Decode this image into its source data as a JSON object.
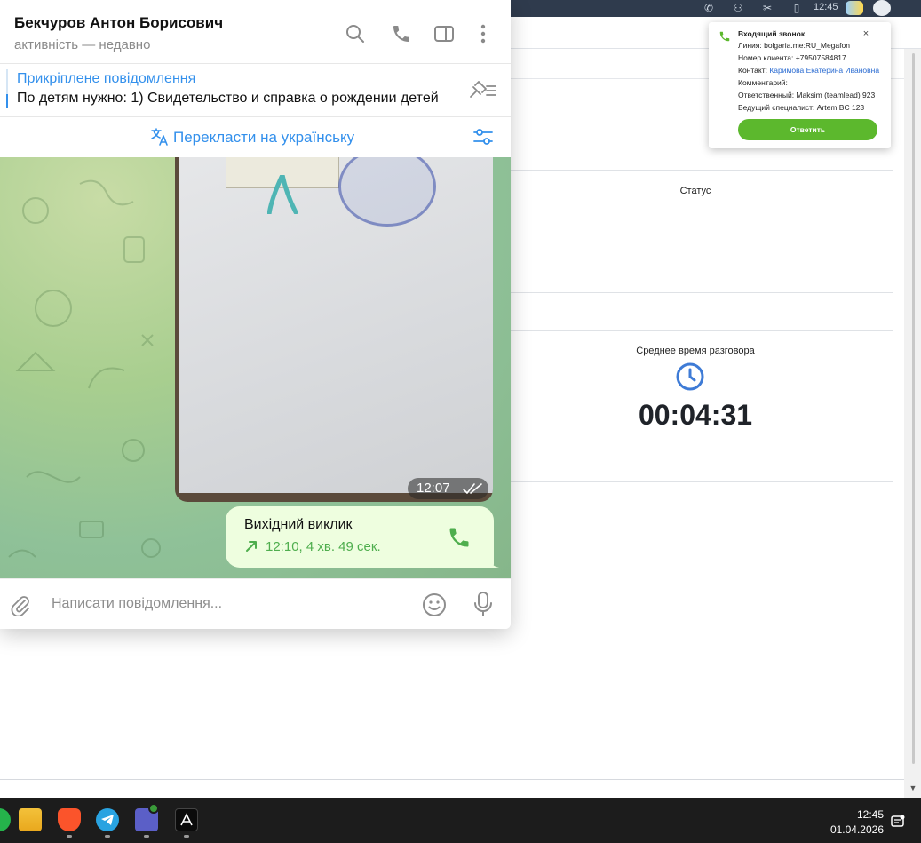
{
  "browser": {
    "time": "12:45"
  },
  "dashboard": {
    "status_card_title": "Статус",
    "avg_time_title": "Среднее время разговора",
    "avg_time_value": "00:04:31"
  },
  "call_toast": {
    "title": "Входящий звонок",
    "line": "Линия: bolgaria.me:RU_Megafon",
    "client_number": "Номер клиента: +79507584817",
    "contact_label": "Контакт:",
    "contact_name": "Каримова Екатерина Ивановна",
    "comment": "Комментарий:",
    "responsible": "Ответственный: Maksim (teamlead) 923",
    "lead_specialist": "Ведущий специалист: Artem BC 123",
    "answer_label": "Ответить",
    "close": "×"
  },
  "telegram": {
    "contact_name": "Бекчуров Антон Борисович",
    "contact_status": "активність — недавно",
    "pinned_title": "Прикріплене повідомлення",
    "pinned_text": "По детям нужно:  1) Свидетельство и справка о рождении детей",
    "translate_label": "Перекласти на українську",
    "photo_time": "12:07",
    "call_title": "Вихідний виклик",
    "call_details": "12:10, 4 хв. 49 сек.",
    "composer_placeholder": "Написати повідомлення..."
  },
  "taskbar": {
    "time": "12:45",
    "date": "01.04.2026"
  },
  "colors": {
    "accent_blue": "#3390ec",
    "call_green": "#4fae4e",
    "answer_green": "#5cb82d",
    "bubble_green": "#eefedf",
    "taskbar": "#1c1c1c",
    "browser_topbar": "#2f3b4d"
  }
}
